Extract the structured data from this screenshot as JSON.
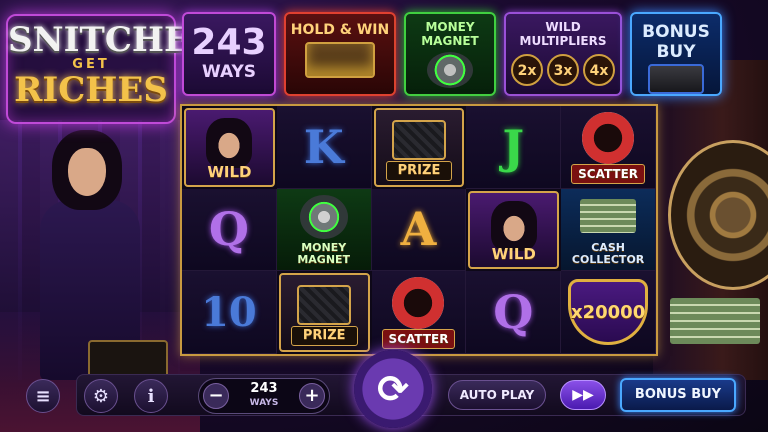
{
  "logo": {
    "line1": "SNITCHES",
    "line2": "GET",
    "line3": "RICHES"
  },
  "features": {
    "ways": {
      "number": "243",
      "unit": "WAYS"
    },
    "hold_win": "HOLD & WIN",
    "money_magnet": "MONEY MAGNET",
    "wild_multipliers": {
      "title": "WILD MULTIPLIERS",
      "values": [
        "2x",
        "3x",
        "4x"
      ]
    },
    "bonus_buy": "BONUS BUY"
  },
  "reels": {
    "row1": [
      {
        "type": "wild",
        "label": "WILD"
      },
      {
        "type": "letter",
        "label": "K"
      },
      {
        "type": "prize",
        "label": "PRIZE"
      },
      {
        "type": "letter",
        "label": "J"
      },
      {
        "type": "scatter",
        "label": "SCATTER"
      }
    ],
    "row2": [
      {
        "type": "letter",
        "label": "Q"
      },
      {
        "type": "magnet",
        "label": "MONEY MAGNET"
      },
      {
        "type": "letter",
        "label": "A"
      },
      {
        "type": "wild",
        "label": "WILD"
      },
      {
        "type": "cash",
        "label": "CASH COLLECTOR"
      }
    ],
    "row3": [
      {
        "type": "letter",
        "label": "10"
      },
      {
        "type": "prize",
        "label": "PRIZE"
      },
      {
        "type": "scatter",
        "label": "SCATTER"
      },
      {
        "type": "letter",
        "label": "Q"
      },
      {
        "type": "multiplier",
        "label": "x20000"
      }
    ]
  },
  "controls": {
    "bet_value": "243",
    "bet_unit": "WAYS",
    "minus": "−",
    "plus": "+",
    "auto_play": "AUTO PLAY",
    "bonus_buy": "BONUS BUY",
    "icons": [
      "menu-icon",
      "gear-icon",
      "info-icon",
      "spin-icon",
      "fast-forward-icon"
    ]
  }
}
